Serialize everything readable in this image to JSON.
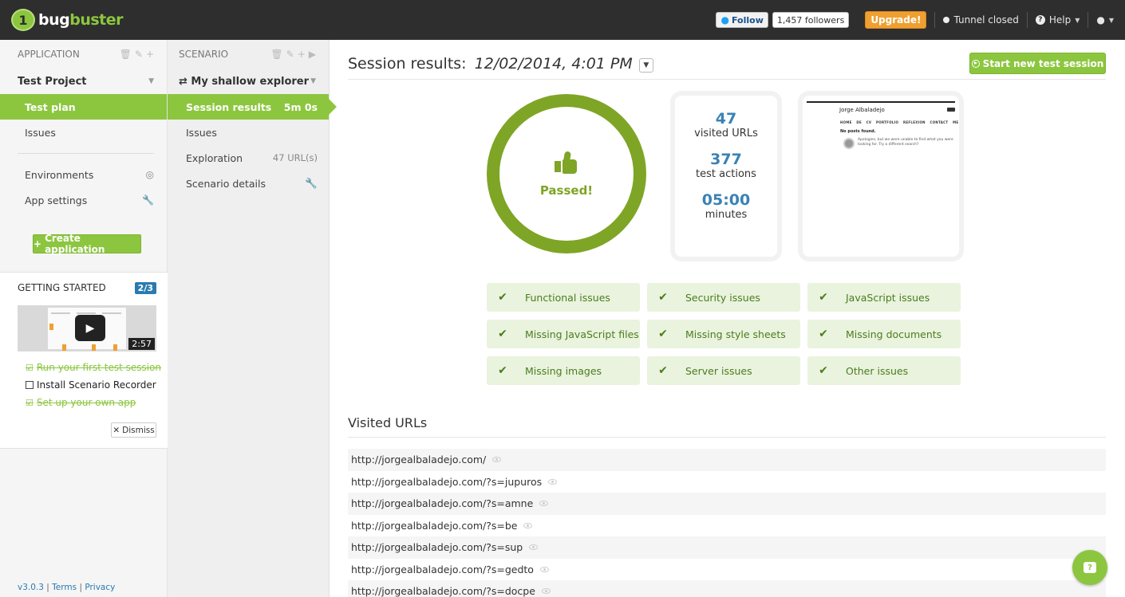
{
  "brand": {
    "badge": "1",
    "name_part1": "bug",
    "name_part2": "buster"
  },
  "topbar": {
    "follow_label": "Follow",
    "followers": "1,457 followers",
    "upgrade": "Upgrade!",
    "tunnel": "Tunnel closed",
    "help": "Help",
    "help_icon": "?"
  },
  "app_sidebar": {
    "header": "APPLICATION",
    "project": "Test Project",
    "items": [
      {
        "label": "Test plan",
        "active": true
      },
      {
        "label": "Issues"
      }
    ],
    "items2": [
      {
        "label": "Environments",
        "icon": "dashboard-icon"
      },
      {
        "label": "App settings",
        "icon": "wrench-icon"
      }
    ],
    "create_button": "Create application"
  },
  "getting_started": {
    "title": "GETTING STARTED",
    "progress": "2/3",
    "video_duration": "2:57",
    "tasks": [
      {
        "label": "Run your first test session",
        "done": true
      },
      {
        "label": "Install Scenario Recorder",
        "done": false
      },
      {
        "label": "Set up your own app",
        "done": true
      }
    ],
    "dismiss": "Dismiss"
  },
  "footer": {
    "version": "v3.0.3",
    "sep": "|",
    "terms": "Terms",
    "privacy": "Privacy"
  },
  "scenario_sidebar": {
    "header": "SCENARIO",
    "title": "My shallow explorer",
    "items": [
      {
        "label": "Session results",
        "meta": "5m 0s",
        "active": true
      },
      {
        "label": "Issues",
        "meta": ""
      },
      {
        "label": "Exploration",
        "meta": "47 URL(s)"
      },
      {
        "label": "Scenario details",
        "meta": ""
      }
    ]
  },
  "main": {
    "title": "Session results:",
    "date": "12/02/2014, 4:01 PM",
    "start_button": "Start new test session",
    "result": "Passed!",
    "stats": [
      {
        "value": "47",
        "label": "visited URLs"
      },
      {
        "value": "377",
        "label": "test actions"
      },
      {
        "value": "05:00",
        "label": "minutes"
      }
    ],
    "screenshot": {
      "site_title": "Jorge Albaladejo",
      "menu": "HOME  DE CV  PORTFOLIO  REFLEXION  CONTACT ME",
      "not_found_title": "No posts found.",
      "not_found_msg": "Apologies, but we were unable to find what you were looking for. Try a different search?"
    },
    "checks": [
      "Functional issues",
      "Security issues",
      "JavaScript issues",
      "Missing JavaScript files",
      "Missing style sheets",
      "Missing documents",
      "Missing images",
      "Server issues",
      "Other issues"
    ],
    "visited_title": "Visited URLs",
    "urls": [
      "http://jorgealbaladejo.com/",
      "http://jorgealbaladejo.com/?s=jupuros",
      "http://jorgealbaladejo.com/?s=amne",
      "http://jorgealbaladejo.com/?s=be",
      "http://jorgealbaladejo.com/?s=sup",
      "http://jorgealbaladejo.com/?s=gedto",
      "http://jorgealbaladejo.com/?s=docpe"
    ]
  },
  "colors": {
    "accent": "#8cc63f",
    "ring": "#7ea525",
    "stat": "#3a82b5",
    "topbar": "#2e2e2e",
    "upgrade": "#f0a030"
  }
}
